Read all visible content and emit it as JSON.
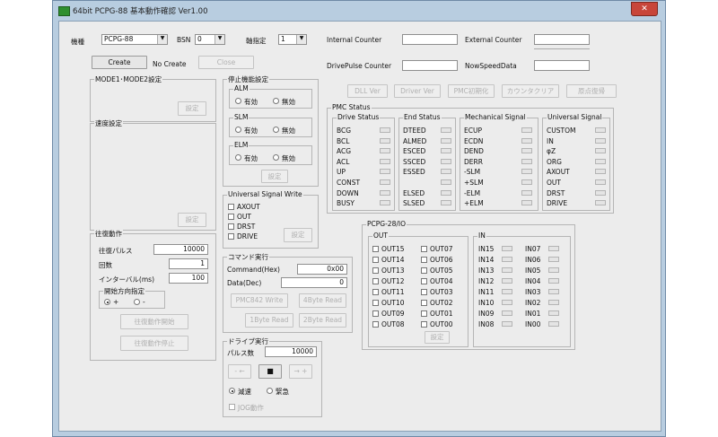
{
  "window": {
    "title": "64bit PCPG-88 基本動作確認 Ver1.00",
    "close_glyph": "✕"
  },
  "top": {
    "kishu_label": "機種",
    "kishu_value": "PCPG-88",
    "bsn_label": "BSN",
    "bsn_value": "0",
    "axis_label": "軸指定",
    "axis_value": "1",
    "create_button": "Create",
    "create_status": "No Create",
    "close_button": "Close"
  },
  "counters": {
    "internal_label": "Internal Counter",
    "external_label": "External Counter",
    "drive_pulse_label": "DrivePulse Counter",
    "now_speed_label": "NowSpeedData"
  },
  "mode_group": {
    "title": "MODE1･MODE2設定",
    "set_button": "設定"
  },
  "speed_group": {
    "title": "速度設定",
    "set_button": "設定"
  },
  "reciprocal": {
    "title": "往復動作",
    "pulse_label": "往復パルス",
    "pulse_value": "10000",
    "count_label": "回数",
    "count_value": "1",
    "interval_label": "インターバル(ms)",
    "interval_value": "100",
    "direction_title": "開始方向指定",
    "plus_label": "+",
    "minus_label": "-",
    "start_button": "往復動作開始",
    "stop_button": "往復動作停止"
  },
  "stop_group": {
    "title": "停止機能設定",
    "alm": "ALM",
    "slm": "SLM",
    "elm": "ELM",
    "valid": "有効",
    "invalid": "無効",
    "set_button": "設定"
  },
  "usw": {
    "title": "Universal Signal Write",
    "items": [
      "AXOUT",
      "OUT",
      "DRST",
      "DRIVE"
    ],
    "set_button": "設定"
  },
  "cmd": {
    "title": "コマンド実行",
    "command_label": "Command(Hex)",
    "command_value": "0x00",
    "data_label": "Data(Dec)",
    "data_value": "0",
    "pmc_write": "PMC842 Write",
    "read4": "4Byte Read",
    "read1": "1Byte Read",
    "read2": "2Byte Read"
  },
  "drive": {
    "title": "ドライブ実行",
    "pulse_label": "パルス数",
    "pulse_value": "10000",
    "minus": "- ←",
    "stop": "■",
    "plus": "→ +",
    "decel": "減速",
    "emergency": "緊急",
    "jog": "JOG動作"
  },
  "top_buttons": [
    "DLL Ver",
    "Driver Ver",
    "PMC初期化",
    "カウンタクリア",
    "原点復帰"
  ],
  "pmc_status": {
    "title": "PMC Status",
    "drive": {
      "title": "Drive Status",
      "items": [
        "BCG",
        "BCL",
        "ACG",
        "ACL",
        "UP",
        "CONST",
        "DOWN",
        "BUSY"
      ]
    },
    "end": {
      "title": "End Status",
      "items": [
        "DTEED",
        "ALMED",
        "ESCED",
        "SSCED",
        "ESSED",
        "",
        "ELSED",
        "SLSED"
      ]
    },
    "mech": {
      "title": "Mechanical Signal",
      "items": [
        "ECUP",
        "ECDN",
        "DEND",
        "DERR",
        "-SLM",
        "+SLM",
        "-ELM",
        "+ELM"
      ]
    },
    "univ": {
      "title": "Universal Signal",
      "items": [
        "CUSTOM",
        "IN",
        "φZ",
        "ORG",
        "AXOUT",
        "OUT",
        "DRST",
        "DRIVE"
      ]
    }
  },
  "io": {
    "title": "PCPG-28/IO",
    "out_title": "OUT",
    "out_left": [
      "OUT15",
      "OUT14",
      "OUT13",
      "OUT12",
      "OUT11",
      "OUT10",
      "OUT09",
      "OUT08"
    ],
    "out_right": [
      "OUT07",
      "OUT06",
      "OUT05",
      "OUT04",
      "OUT03",
      "OUT02",
      "OUT01",
      "OUT00"
    ],
    "set_button": "設定",
    "in_title": "IN",
    "in_left": [
      "IN15",
      "IN14",
      "IN13",
      "IN12",
      "IN11",
      "IN10",
      "IN09",
      "IN08"
    ],
    "in_right": [
      "IN07",
      "IN06",
      "IN05",
      "IN04",
      "IN03",
      "IN02",
      "IN01",
      "IN00"
    ]
  }
}
